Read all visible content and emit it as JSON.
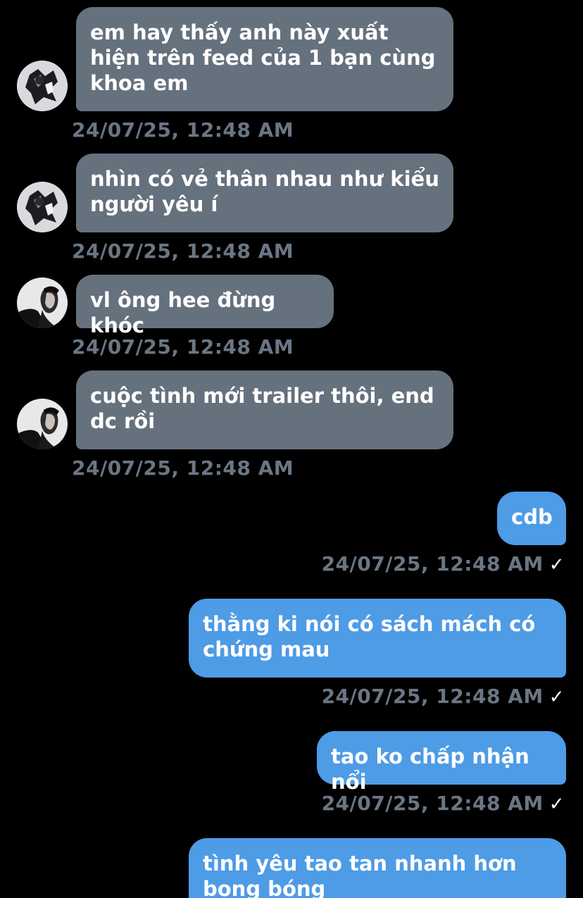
{
  "colors": {
    "background": "#000000",
    "incoming_bubble": "#66717e",
    "outgoing_bubble": "#4e9be6",
    "timestamp": "#6b7684"
  },
  "messages": [
    {
      "direction": "incoming",
      "text": "em hay thấy anh này xuất hiện trên feed của 1 bạn cùng khoa em",
      "timestamp": "24/07/25, 12:48 AM",
      "avatar": "contact-a-avatar"
    },
    {
      "direction": "incoming",
      "text": "nhìn có vẻ thân nhau như kiểu người yêu í",
      "timestamp": "24/07/25, 12:48 AM",
      "avatar": "contact-a-avatar"
    },
    {
      "direction": "incoming",
      "text": "vl ông hee đừng khóc",
      "timestamp": "24/07/25, 12:48 AM",
      "avatar": "contact-b-avatar"
    },
    {
      "direction": "incoming",
      "text": "cuộc tình mới trailer thôi, end dc rồi",
      "timestamp": "24/07/25, 12:48 AM",
      "avatar": "contact-b-avatar"
    },
    {
      "direction": "outgoing",
      "text": "cdb",
      "timestamp": "24/07/25, 12:48 AM",
      "status_icon": "check-icon",
      "status_glyph": "✓"
    },
    {
      "direction": "outgoing",
      "text": "thằng ki nói có sách mách có chứng mau",
      "timestamp": "24/07/25, 12:48 AM",
      "status_icon": "check-icon",
      "status_glyph": "✓"
    },
    {
      "direction": "outgoing",
      "text": "tao ko chấp nhận nổi",
      "timestamp": "24/07/25, 12:48 AM",
      "status_icon": "check-icon",
      "status_glyph": "✓"
    },
    {
      "direction": "outgoing",
      "text": "tình yêu tao tan nhanh hơn bong bóng",
      "timestamp": "",
      "status_icon": ""
    }
  ]
}
